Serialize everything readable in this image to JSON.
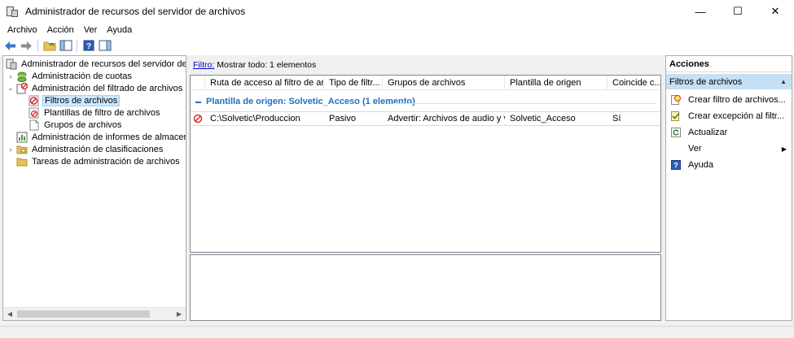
{
  "window": {
    "title": "Administrador de recursos del servidor de archivos",
    "minimize_glyph": "—",
    "maximize_glyph": "☐",
    "close_glyph": "✕"
  },
  "menu": [
    "Archivo",
    "Acción",
    "Ver",
    "Ayuda"
  ],
  "toolbar": {
    "icons": [
      "back-arrow-icon",
      "forward-arrow-icon",
      "up-folder-icon",
      "show-hide-tree-icon",
      "help-icon",
      "show-hide-action-pane-icon"
    ]
  },
  "tree": {
    "root": "Administrador de recursos del servidor de arch",
    "items": [
      {
        "label": "Administración de cuotas",
        "expander": "›"
      },
      {
        "label": "Administración del filtrado de archivos",
        "expander": "⌄"
      },
      {
        "label": "Filtros de archivos",
        "expander": ""
      },
      {
        "label": "Plantillas de filtro de archivos",
        "expander": ""
      },
      {
        "label": "Grupos de archivos",
        "expander": ""
      },
      {
        "label": "Administración de informes de almacenam",
        "expander": ""
      },
      {
        "label": "Administración de clasificaciones",
        "expander": "›"
      },
      {
        "label": "Tareas de administración de archivos",
        "expander": ""
      }
    ],
    "scroll_left": "◀",
    "scroll_right": "▶"
  },
  "filter": {
    "link": "Filtro:",
    "text": "Mostrar todo: 1 elementos"
  },
  "table": {
    "columns": [
      "Ruta de acceso al filtro de ar...",
      "Tipo de filtr...",
      "Grupos de archivos",
      "Plantilla de origen",
      "Coincide c..."
    ],
    "group_toggle": "▬",
    "group_label": "Plantilla de origen: Solvetic_Acceso (1 elemento)",
    "rows": [
      [
        "C:\\Solvetic\\Produccion",
        "Pasivo",
        "Advertir: Archivos de audio y v...",
        "Solvetic_Acceso",
        "Sí"
      ]
    ]
  },
  "actions": {
    "title": "Acciones",
    "section": "Filtros de archivos",
    "section_arrow": "▲",
    "items": [
      {
        "label": "Crear filtro de archivos...",
        "icon": "create-filter-icon"
      },
      {
        "label": "Crear excepción al filtr...",
        "icon": "create-exception-icon"
      },
      {
        "label": "Actualizar",
        "icon": "refresh-icon"
      },
      {
        "label": "Ver",
        "icon": "",
        "submenu": "▶"
      },
      {
        "label": "Ayuda",
        "icon": "help-icon"
      }
    ]
  },
  "colors": {
    "selection": "#cce8ff",
    "group_text": "#1e6fc7",
    "action_section": "#c5dff4"
  }
}
